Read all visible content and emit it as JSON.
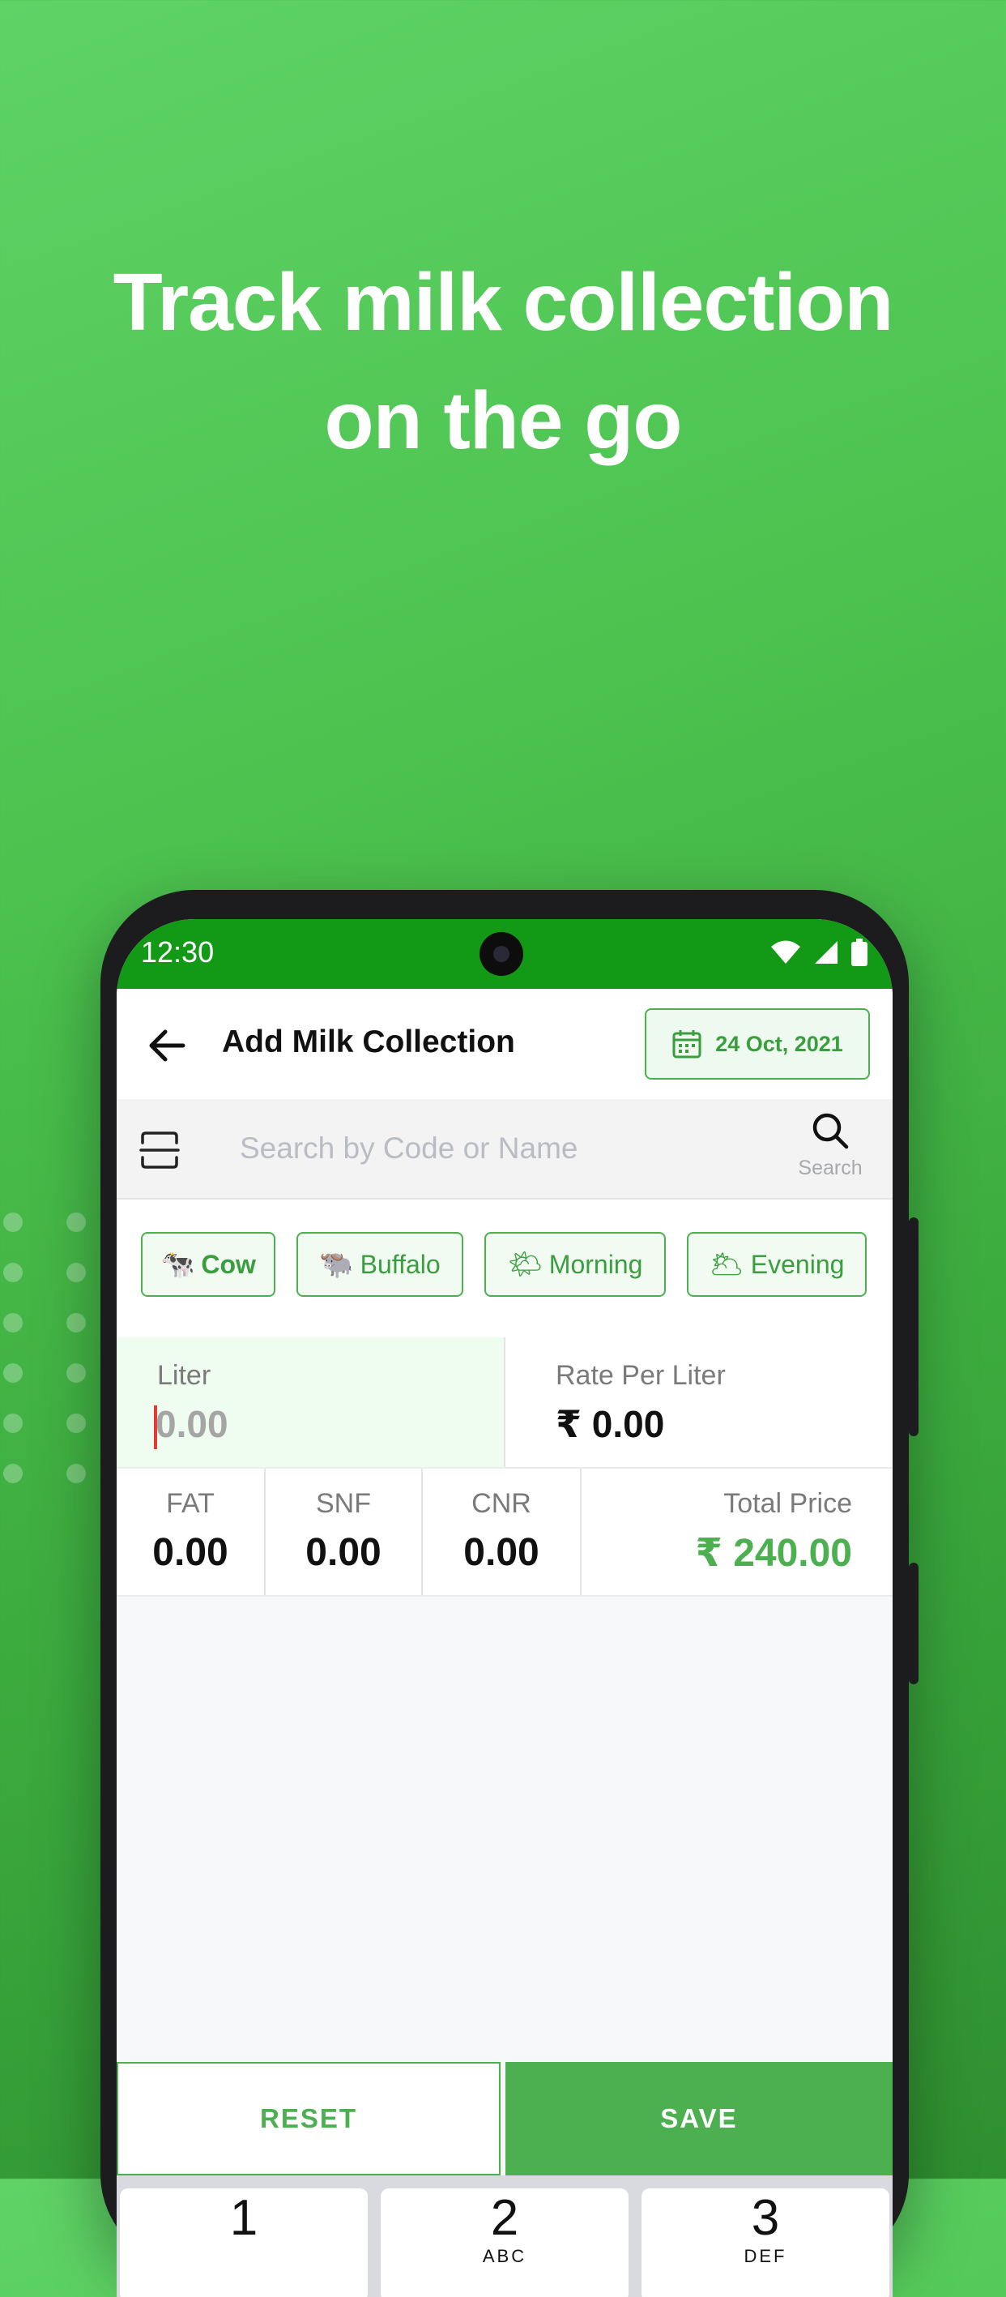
{
  "headline": {
    "line1": "Track milk collection",
    "line2": "on the go"
  },
  "status_bar": {
    "time": "12:30",
    "icons": [
      "wifi-icon",
      "signal-icon",
      "battery-icon"
    ]
  },
  "app_bar": {
    "title": "Add Milk Collection",
    "date": "24 Oct, 2021",
    "back_icon": "arrow-left-icon",
    "date_icon": "calendar-icon"
  },
  "search": {
    "placeholder": "Search by Code or Name",
    "button_label": "Search",
    "scan_icon": "scan-icon",
    "search_icon": "search-icon"
  },
  "chips": [
    {
      "label": "Cow",
      "emoji": "🐄",
      "selected": true
    },
    {
      "label": "Buffalo",
      "emoji": "🐃",
      "selected": false
    },
    {
      "label": "Morning",
      "emoji": "🌤",
      "selected": false
    },
    {
      "label": "Evening",
      "emoji": "🌥",
      "selected": false
    }
  ],
  "fields": {
    "liter": {
      "label": "Liter",
      "placeholder": "0.00"
    },
    "rate": {
      "label": "Rate Per Liter",
      "value": "₹ 0.00"
    }
  },
  "stats": [
    {
      "label": "FAT",
      "value": "0.00"
    },
    {
      "label": "SNF",
      "value": "0.00"
    },
    {
      "label": "CNR",
      "value": "0.00"
    }
  ],
  "total": {
    "label": "Total Price",
    "value": "₹ 240.00"
  },
  "actions": {
    "reset": "RESET",
    "save": "SAVE"
  },
  "keypad": [
    {
      "digit": "1",
      "sub": ""
    },
    {
      "digit": "2",
      "sub": "ABC"
    },
    {
      "digit": "3",
      "sub": "DEF"
    }
  ],
  "colors": {
    "brand_green": "#4caf50",
    "status_bar": "#129a16",
    "background_top": "#5fd366"
  }
}
